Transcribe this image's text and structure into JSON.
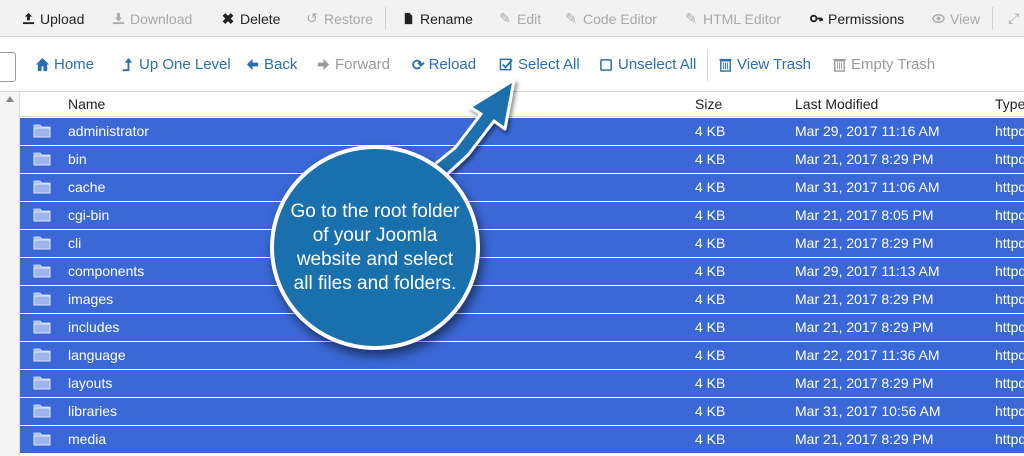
{
  "toolbar": {
    "items": [
      {
        "label": "Upload",
        "icon": "upload-icon",
        "enabled": true
      },
      {
        "label": "Download",
        "icon": "download-icon",
        "enabled": false
      },
      {
        "label": "Delete",
        "icon": "delete-icon",
        "enabled": true
      },
      {
        "label": "Restore",
        "icon": "restore-icon",
        "enabled": false
      },
      {
        "label": "Rename",
        "icon": "rename-icon",
        "enabled": true
      },
      {
        "label": "Edit",
        "icon": "edit-icon",
        "enabled": false
      },
      {
        "label": "Code Editor",
        "icon": "code-editor-icon",
        "enabled": false
      },
      {
        "label": "HTML Editor",
        "icon": "html-editor-icon",
        "enabled": false
      },
      {
        "label": "Permissions",
        "icon": "key-icon",
        "enabled": true
      },
      {
        "label": "View",
        "icon": "eye-icon",
        "enabled": false
      }
    ]
  },
  "nav": {
    "items": [
      {
        "label": "Home",
        "icon": "home-icon",
        "enabled": true
      },
      {
        "label": "Up One Level",
        "icon": "level-up-icon",
        "enabled": true
      },
      {
        "label": "Back",
        "icon": "arrow-left-icon",
        "enabled": true
      },
      {
        "label": "Forward",
        "icon": "arrow-right-icon",
        "enabled": false
      },
      {
        "label": "Reload",
        "icon": "reload-icon",
        "enabled": true
      },
      {
        "label": "Select All",
        "icon": "checkbox-checked-icon",
        "enabled": true
      },
      {
        "label": "Unselect All",
        "icon": "checkbox-empty-icon",
        "enabled": true
      },
      {
        "label": "View Trash",
        "icon": "trash-icon",
        "enabled": true
      },
      {
        "label": "Empty Trash",
        "icon": "trash-icon",
        "enabled": false
      }
    ]
  },
  "table": {
    "headers": [
      "Name",
      "Size",
      "Last Modified",
      "Type"
    ],
    "rows": [
      {
        "name": "administrator",
        "size": "4 KB",
        "modified": "Mar 29, 2017 11:16 AM",
        "type": "httpd"
      },
      {
        "name": "bin",
        "size": "4 KB",
        "modified": "Mar 21, 2017 8:29 PM",
        "type": "httpd"
      },
      {
        "name": "cache",
        "size": "4 KB",
        "modified": "Mar 31, 2017 11:06 AM",
        "type": "httpd"
      },
      {
        "name": "cgi-bin",
        "size": "4 KB",
        "modified": "Mar 21, 2017 8:05 PM",
        "type": "httpd"
      },
      {
        "name": "cli",
        "size": "4 KB",
        "modified": "Mar 21, 2017 8:29 PM",
        "type": "httpd"
      },
      {
        "name": "components",
        "size": "4 KB",
        "modified": "Mar 29, 2017 11:13 AM",
        "type": "httpd"
      },
      {
        "name": "images",
        "size": "4 KB",
        "modified": "Mar 21, 2017 8:29 PM",
        "type": "httpd"
      },
      {
        "name": "includes",
        "size": "4 KB",
        "modified": "Mar 21, 2017 8:29 PM",
        "type": "httpd"
      },
      {
        "name": "language",
        "size": "4 KB",
        "modified": "Mar 22, 2017 11:36 AM",
        "type": "httpd"
      },
      {
        "name": "layouts",
        "size": "4 KB",
        "modified": "Mar 21, 2017 8:29 PM",
        "type": "httpd"
      },
      {
        "name": "libraries",
        "size": "4 KB",
        "modified": "Mar 31, 2017 10:56 AM",
        "type": "httpd"
      },
      {
        "name": "media",
        "size": "4 KB",
        "modified": "Mar 21, 2017 8:29 PM",
        "type": "httpd"
      }
    ]
  },
  "callout": {
    "text": "Go to the root folder of your Joomla website and select all files and folders."
  },
  "colors": {
    "selected_row": "#3a68d6",
    "link": "#2a6fb0",
    "callout": "#1a70ad"
  }
}
